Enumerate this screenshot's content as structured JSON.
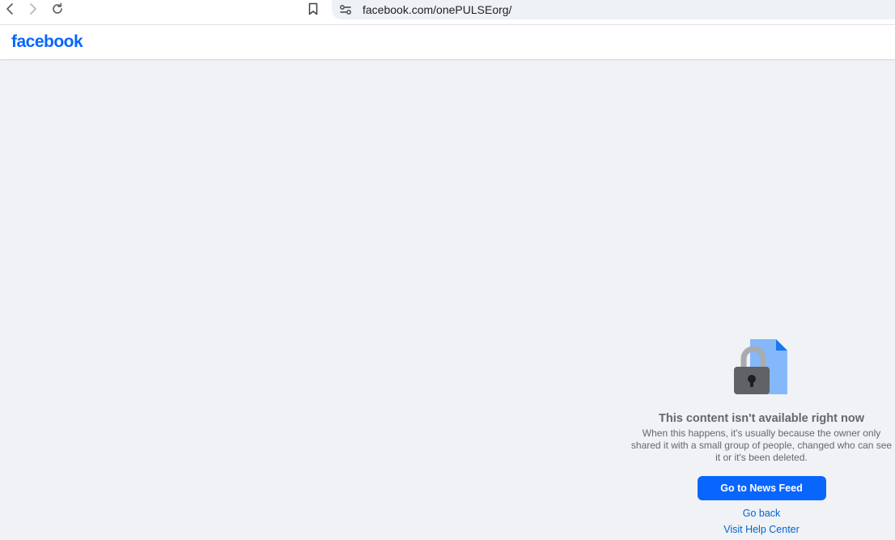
{
  "browser": {
    "url": "facebook.com/onePULSEorg/",
    "icons": [
      "back-icon",
      "forward-icon",
      "reload-icon",
      "bookmark-icon",
      "site-info-icon"
    ]
  },
  "header": {
    "logo_text": "facebook"
  },
  "main": {
    "title": "This content isn't available right now",
    "description": "When this happens, it's usually because the owner only shared it with a small group of people, changed who can see it or it's been deleted.",
    "primary_button": "Go to News Feed",
    "go_back_link": "Go back",
    "help_link": "Visit Help Center",
    "illustration": "lock-document-icon"
  },
  "colors": {
    "brand": "#0866ff",
    "background": "#f0f2f5",
    "secondary_text": "#65676b",
    "link": "#0064d1"
  }
}
